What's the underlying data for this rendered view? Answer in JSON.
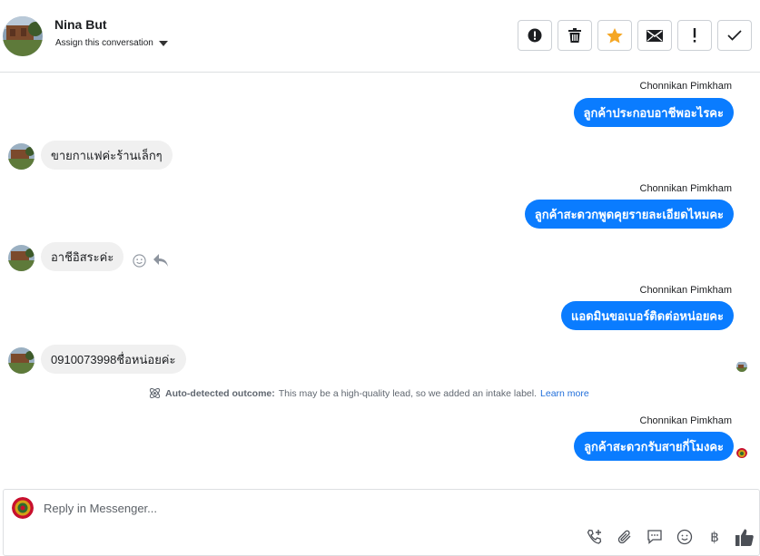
{
  "header": {
    "contact_name": "Nina But",
    "assign_label": "Assign this conversation",
    "toolbar": [
      "spam-icon",
      "trash-icon",
      "star-icon",
      "mail-icon",
      "exclamation-icon",
      "check-icon"
    ]
  },
  "messages": [
    {
      "type": "out",
      "sender": "Chonnikan Pimkham",
      "text": "ลูกค้าประกอบอาชีพอะไรคะ"
    },
    {
      "type": "in",
      "text": "ขายกาแฟค่ะร้านเล็กๆ"
    },
    {
      "type": "out",
      "sender": "Chonnikan Pimkham",
      "text": "ลูกค้าสะดวกพูดคุยรายละเอียดไหมคะ"
    },
    {
      "type": "in",
      "text": "อาชีอิสระค่ะ"
    },
    {
      "type": "out",
      "sender": "Chonnikan Pimkham",
      "text": "แอดมินขอเบอร์ติดต่อหน่อยคะ"
    },
    {
      "type": "in",
      "text": "0910073998ชื่อหน่อยค่ะ"
    },
    {
      "type": "out",
      "sender": "Chonnikan Pimkham",
      "text": "ลูกค้าสะดวกรับสายกี่โมงคะ"
    }
  ],
  "notice": {
    "label": "Auto-detected outcome:",
    "text": "This may be a high-quality lead, so we added an intake label.",
    "link": "Learn more"
  },
  "composer": {
    "placeholder": "Reply in Messenger...",
    "currency_symbol": "฿"
  },
  "colors": {
    "accent": "#0a7cff",
    "star": "#f5a623",
    "incoming_bg": "#f0f0f0"
  }
}
